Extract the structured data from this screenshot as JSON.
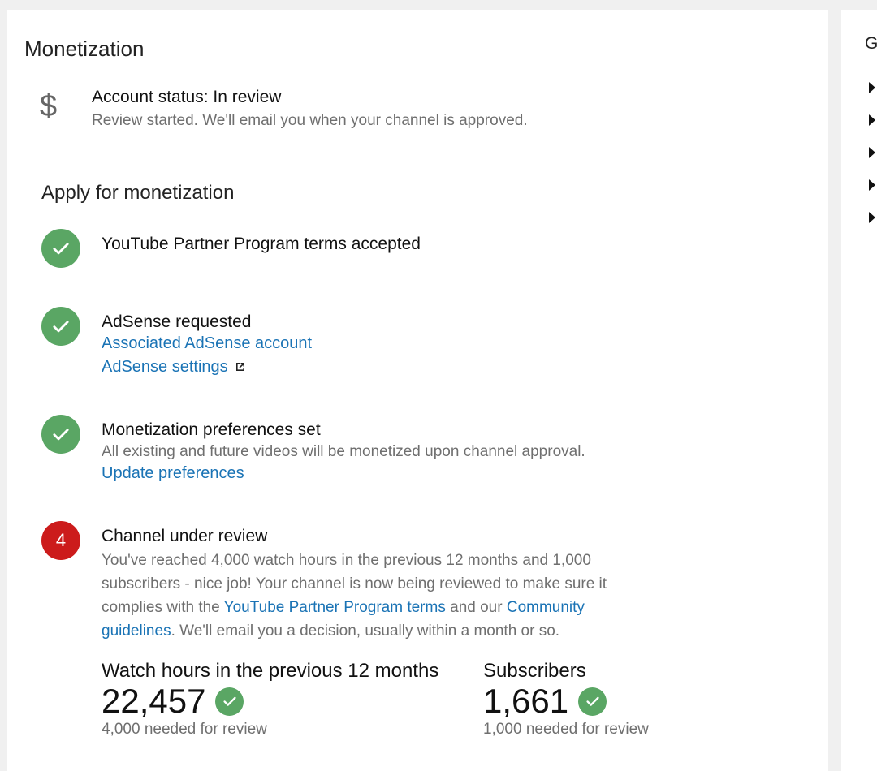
{
  "page_title": "Monetization",
  "account_status": {
    "icon": "dollar-icon",
    "title": "Account status: In review",
    "subtitle": "Review started. We'll email you when your channel is approved."
  },
  "section_title": "Apply for monetization",
  "steps": [
    {
      "status": "done",
      "title": "YouTube Partner Program terms accepted"
    },
    {
      "status": "done",
      "title": "AdSense requested",
      "link1": "Associated AdSense account",
      "link2": "AdSense settings"
    },
    {
      "status": "done",
      "title": "Monetization preferences set",
      "text": "All existing and future videos will be monetized upon channel approval.",
      "link": "Update preferences"
    },
    {
      "status": "pending",
      "number": "4",
      "title": "Channel under review",
      "text_part1": "You've reached 4,000 watch hours in the previous 12 months and 1,000 subscribers - nice job! Your channel is now being reviewed to make sure it complies with the ",
      "link_ypp": "YouTube Partner Program terms",
      "text_part2": " and our ",
      "link_community": "Community guidelines",
      "text_part3": ". We'll email you a decision, usually within a month or so."
    }
  ],
  "metrics": [
    {
      "label": "Watch hours in the previous 12 months",
      "value": "22,457",
      "note": "4,000 needed for review"
    },
    {
      "label": "Subscribers",
      "value": "1,661",
      "note": "1,000 needed for review"
    }
  ],
  "side_panel": {
    "title_initial": "G"
  },
  "colors": {
    "accent_link": "#1a73b5",
    "success": "#5aa664",
    "alert": "#cc1b1b"
  }
}
